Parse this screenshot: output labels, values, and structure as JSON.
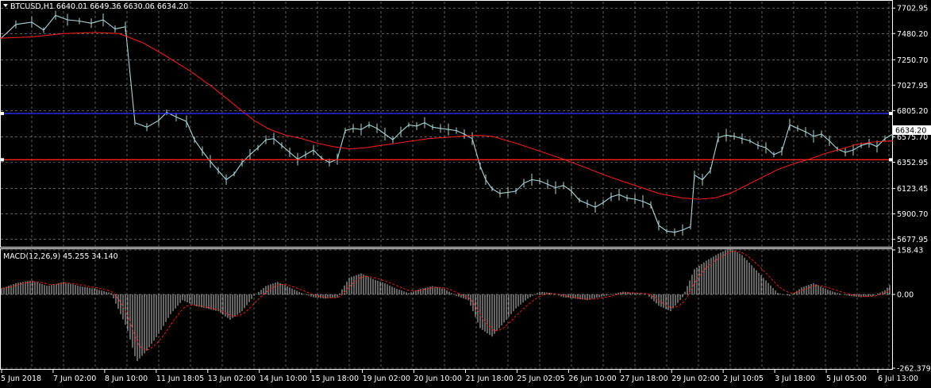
{
  "chart_data": [
    {
      "type": "line",
      "header": "BTCUSD,H1  6640.01 6649.36 6630.06 6634.20",
      "symbol": "BTCUSD",
      "timeframe": "H1",
      "ohlc": {
        "open": 6640.01,
        "high": 6649.36,
        "low": 6630.06,
        "close": 6634.2
      },
      "current_price_label": "6634.20",
      "ylim": [
        5620,
        7760
      ],
      "y_ticks": [
        "7702.95",
        "7480.20",
        "7250.70",
        "7027.95",
        "6805.20",
        "6575.70",
        "6352.95",
        "6123.45",
        "5900.70",
        "5677.95"
      ],
      "x_ticks": [
        "5 Jun 2018",
        "7 Jun 02:00",
        "8 Jun 10:00",
        "11 Jun 18:05",
        "13 Jun 02:00",
        "14 Jun 10:00",
        "15 Jun 18:00",
        "19 Jun 02:00",
        "20 Jun 10:00",
        "21 Jun 18:00",
        "25 Jun 02:05",
        "26 Jun 10:00",
        "27 Jun 18:00",
        "29 Jun 02:00",
        "2 Jul 10:05",
        "3 Jul 18:00",
        "5 Jul 05:00",
        "6 Jul 13:00"
      ],
      "grid": true,
      "horizontal_lines": [
        {
          "name": "blue level",
          "value": 6780,
          "color": "#2b2bff"
        },
        {
          "name": "red level",
          "value": 6375,
          "color": "#ff2020"
        }
      ],
      "series": [
        {
          "style": "price",
          "color": "#a9d6d6",
          "x": [
            0,
            20,
            40,
            55,
            70,
            85,
            100,
            115,
            130,
            145,
            158,
            170,
            185,
            200,
            210,
            222,
            235,
            245,
            255,
            265,
            275,
            285,
            295,
            305,
            315,
            325,
            335,
            345,
            355,
            365,
            375,
            385,
            395,
            405,
            415,
            425,
            435,
            445,
            455,
            465,
            475,
            485,
            495,
            505,
            515,
            525,
            535,
            545,
            555,
            565,
            575,
            585,
            595,
            605,
            612,
            620,
            630,
            640,
            650,
            660,
            670,
            680,
            690,
            700,
            710,
            720,
            730,
            740,
            750,
            760,
            770,
            780,
            790,
            800,
            810,
            820,
            830,
            840,
            850,
            860,
            870,
            875,
            885,
            895,
            905,
            915,
            925,
            935,
            945,
            955,
            965,
            975,
            985,
            995,
            1005,
            1015,
            1025,
            1035,
            1045,
            1055,
            1065,
            1075,
            1085,
            1095,
            1105,
            1115,
            1125
          ],
          "values": [
            7430,
            7560,
            7580,
            7510,
            7640,
            7600,
            7590,
            7570,
            7600,
            7520,
            7540,
            6700,
            6660,
            6720,
            6790,
            6750,
            6710,
            6550,
            6450,
            6360,
            6280,
            6200,
            6250,
            6350,
            6420,
            6480,
            6550,
            6560,
            6500,
            6440,
            6380,
            6420,
            6460,
            6390,
            6350,
            6380,
            6630,
            6650,
            6640,
            6680,
            6650,
            6600,
            6550,
            6620,
            6680,
            6670,
            6700,
            6660,
            6650,
            6640,
            6630,
            6600,
            6560,
            6320,
            6200,
            6120,
            6080,
            6090,
            6100,
            6170,
            6200,
            6190,
            6160,
            6130,
            6150,
            6100,
            6020,
            5990,
            5960,
            6000,
            6050,
            6070,
            6040,
            6030,
            6010,
            5980,
            5800,
            5750,
            5740,
            5760,
            5790,
            6240,
            6200,
            6280,
            6570,
            6590,
            6580,
            6560,
            6540,
            6500,
            6480,
            6420,
            6450,
            6680,
            6650,
            6620,
            6580,
            6600,
            6540,
            6470,
            6440,
            6460,
            6500,
            6520,
            6490,
            6560,
            6600
          ]
        },
        {
          "style": "ma",
          "color": "#e81c1c",
          "x": [
            0,
            40,
            80,
            120,
            150,
            180,
            210,
            240,
            270,
            300,
            320,
            340,
            360,
            380,
            400,
            420,
            440,
            460,
            480,
            500,
            520,
            540,
            560,
            580,
            600,
            620,
            650,
            680,
            710,
            740,
            770,
            800,
            830,
            860,
            880,
            900,
            920,
            940,
            960,
            980,
            1000,
            1020,
            1040,
            1060,
            1080,
            1100,
            1125
          ],
          "values": [
            7440,
            7450,
            7480,
            7490,
            7480,
            7400,
            7280,
            7150,
            7000,
            6830,
            6720,
            6640,
            6590,
            6560,
            6520,
            6490,
            6470,
            6480,
            6500,
            6520,
            6540,
            6560,
            6570,
            6580,
            6590,
            6580,
            6520,
            6450,
            6380,
            6300,
            6220,
            6150,
            6080,
            6040,
            6030,
            6040,
            6080,
            6150,
            6220,
            6290,
            6340,
            6380,
            6430,
            6470,
            6510,
            6530,
            6540
          ]
        }
      ]
    },
    {
      "type": "bar",
      "header": "MACD(12,26,9) 45.255 34.140",
      "indicator": "MACD",
      "params": "12,26,9",
      "main_value": "45.255",
      "signal_value": "34.140",
      "ylim": [
        -262.379,
        158.43
      ],
      "y_ticks": [
        "158.43",
        "0.00",
        "-262.379"
      ],
      "histogram": {
        "color": "#c9c9c9",
        "x": [
          0,
          20,
          40,
          60,
          80,
          100,
          120,
          140,
          160,
          172,
          185,
          200,
          215,
          230,
          245,
          260,
          275,
          290,
          305,
          320,
          335,
          350,
          365,
          380,
          395,
          410,
          425,
          440,
          455,
          470,
          485,
          500,
          515,
          530,
          545,
          560,
          575,
          590,
          605,
          620,
          635,
          650,
          665,
          680,
          695,
          710,
          725,
          740,
          755,
          770,
          785,
          800,
          815,
          830,
          845,
          860,
          875,
          890,
          905,
          920,
          935,
          950,
          965,
          980,
          995,
          1010,
          1025,
          1040,
          1055,
          1070,
          1085,
          1100,
          1115,
          1125
        ],
        "values": [
          20,
          40,
          50,
          30,
          45,
          30,
          20,
          5,
          -120,
          -240,
          -200,
          -140,
          -70,
          -20,
          -40,
          -50,
          -60,
          -90,
          -60,
          -5,
          30,
          45,
          25,
          5,
          -10,
          -15,
          -10,
          60,
          75,
          55,
          40,
          20,
          5,
          20,
          30,
          20,
          -5,
          -20,
          -120,
          -150,
          -100,
          -50,
          -15,
          10,
          5,
          -10,
          -15,
          -20,
          -10,
          0,
          10,
          5,
          0,
          -40,
          -60,
          -10,
          90,
          120,
          145,
          165,
          140,
          95,
          50,
          5,
          -5,
          25,
          40,
          20,
          5,
          -5,
          -10,
          -5,
          15,
          45
        ],
        "signal_color": "#e81c1c"
      }
    }
  ]
}
